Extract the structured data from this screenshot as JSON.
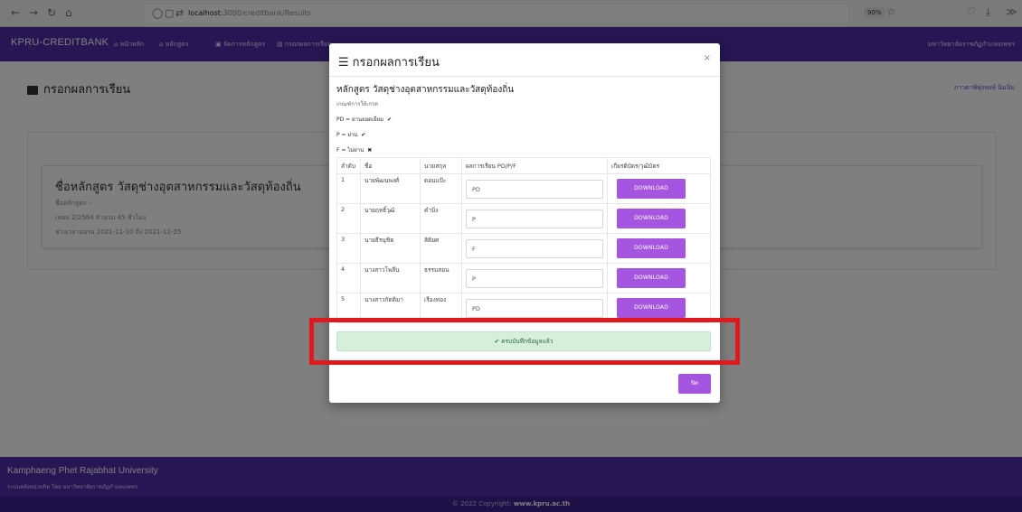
{
  "browser": {
    "url_host": "localhost",
    "url_path": ":3000/creditbank/Results",
    "zoom": "90%"
  },
  "navbar": {
    "brand": "KPRU-CREDITBANK",
    "items": [
      "หน้าหลัก",
      "หลักสูตร",
      "จัดการหลักสูตร",
      "กรอกผลการเรียน"
    ],
    "right_text": "มหาวิทยาลัยราชภัฏกำแพงเพชร"
  },
  "page": {
    "title": "กรอกผลการเรียน",
    "right_link": "ภาวดาพิพุ่งพงษ์ นิ่มนิ่ม",
    "course_card": {
      "name": "ชื่อหลักสูตร วัสดุช่างอุตสาหกรรมและวัสดุท้องถิ่น",
      "meta1": "ชื่อหลักสูตร -",
      "meta2": "เทอม 2/2564 จำนวน 45 ชั่วโมง",
      "meta3": "ช่วงเวลาอบรม 2021-11-10 ถึง 2021-11-25"
    }
  },
  "footer": {
    "title": "Kamphaeng Phet Rajabhat University",
    "subtitle": "ระบบคลังหน่วยกิต โดย มหาวิทยาลัยราชภัฏกำแพงเพชร",
    "copyright_prefix": "© 2022 Copyright:",
    "copyright_link": "www.kpru.ac.th"
  },
  "modal": {
    "title": "กรอกผลการเรียน",
    "course_label": "หลักสูตร วัสดุช่างอุตสาหกรรมและวัสดุท้องถิ่น",
    "criteria_title": "เกณฑ์การให้เกรด",
    "criteria": [
      {
        "text": "PD = ผ่านยอดเยี่ยม",
        "mark": "✔"
      },
      {
        "text": "P = ผ่าน",
        "mark": "✔"
      },
      {
        "text": "F = ไม่ผ่าน",
        "mark": "✖"
      }
    ],
    "table": {
      "headers": [
        "ลำดับ",
        "ชื่อ",
        "นามสกุล",
        "ผลการเรียน PD/P/F",
        "เกียรติบัตร/วุฒิบัตร"
      ],
      "rows": [
        {
          "no": "1",
          "first": "นายพัฒนพงศ์",
          "last": "ดอนแป้ะ",
          "grade": "PD"
        },
        {
          "no": "2",
          "first": "นายฤทธิ์วุฒิ",
          "last": "คำบิ่ง",
          "grade": "P"
        },
        {
          "no": "3",
          "first": "นายธีรนุชิต",
          "last": "สิติยศ",
          "grade": "F"
        },
        {
          "no": "4",
          "first": "นางสาวโพลีน",
          "last": "ธรรมสอน",
          "grade": "P"
        },
        {
          "no": "5",
          "first": "นางสาวกัตติมา",
          "last": "เรืองทอง",
          "grade": "PD"
        }
      ],
      "download_label": "DOWNLOAD"
    },
    "success_message": "ครบบันทึกข้อมูลแล้ว",
    "close_label": "ปิด"
  },
  "colors": {
    "brand": "#4f2da7",
    "accent_button": "#a555e0",
    "success_bg": "#d6efdb",
    "highlight": "#e0191f"
  }
}
